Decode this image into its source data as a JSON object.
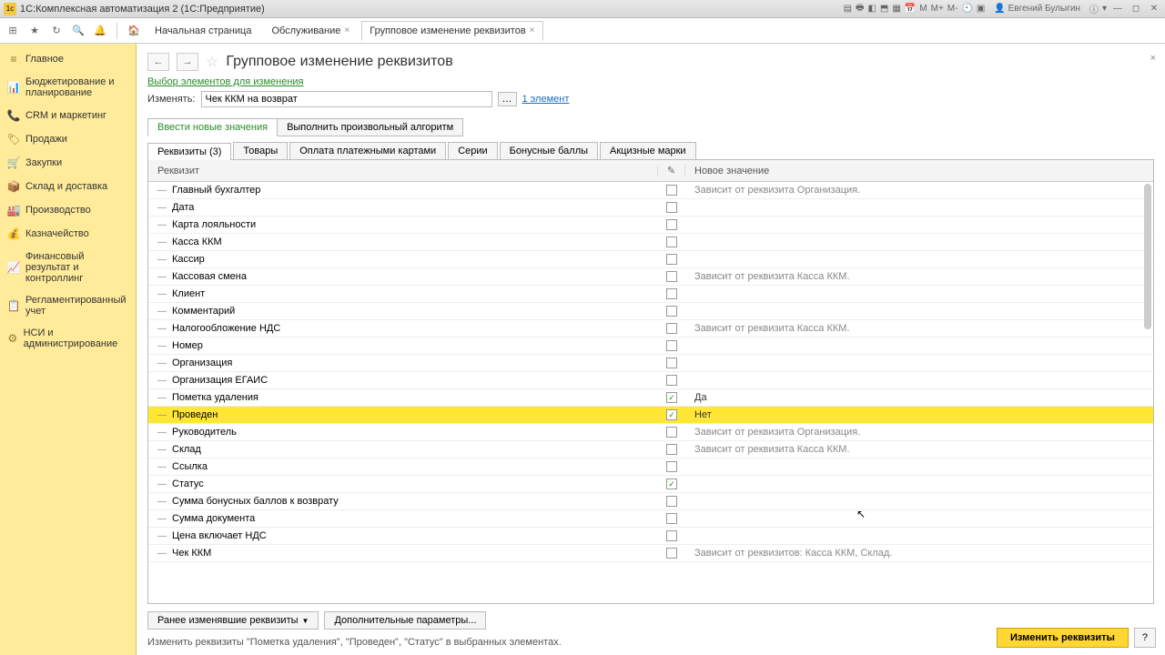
{
  "titlebar": {
    "app": "1С:Комплексная автоматизация 2  (1С:Предприятие)",
    "user": "Евгений Булыгин"
  },
  "tabs": {
    "home": "Начальная страница",
    "t1": "Обслуживание",
    "t2": "Групповое изменение реквизитов"
  },
  "sidebar": {
    "items": [
      "Главное",
      "Бюджетирование и планирование",
      "CRM и маркетинг",
      "Продажи",
      "Закупки",
      "Склад и доставка",
      "Производство",
      "Казначейство",
      "Финансовый результат и контроллинг",
      "Регламентированный учет",
      "НСИ и администрирование"
    ]
  },
  "page": {
    "title": "Групповое изменение реквизитов",
    "select_title": "Выбор элементов для изменения",
    "change_label": "Изменять:",
    "change_value": "Чек ККМ на возврат",
    "count_link": "1 элемент",
    "mode1": "Ввести новые значения",
    "mode2": "Выполнить произвольный алгоритм"
  },
  "inner_tabs": [
    "Реквизиты (3)",
    "Товары",
    "Оплата платежными картами",
    "Серии",
    "Бонусные баллы",
    "Акцизные марки"
  ],
  "grid": {
    "col_name": "Реквизит",
    "col_val": "Новое значение",
    "rows": [
      {
        "name": "Главный бухгалтер",
        "val": "Зависит от реквизита Организация.",
        "chk": false
      },
      {
        "name": "Дата",
        "val": "",
        "chk": false
      },
      {
        "name": "Карта лояльности",
        "val": "",
        "chk": false
      },
      {
        "name": "Касса ККМ",
        "val": "",
        "chk": false
      },
      {
        "name": "Кассир",
        "val": "",
        "chk": false
      },
      {
        "name": "Кассовая смена",
        "val": "Зависит от реквизита Касса ККМ.",
        "chk": false
      },
      {
        "name": "Клиент",
        "val": "",
        "chk": false
      },
      {
        "name": "Комментарий",
        "val": "",
        "chk": false
      },
      {
        "name": "Налогообложение НДС",
        "val": "Зависит от реквизита Касса ККМ.",
        "chk": false
      },
      {
        "name": "Номер",
        "val": "",
        "chk": false
      },
      {
        "name": "Организация",
        "val": "",
        "chk": false
      },
      {
        "name": "Организация ЕГАИС",
        "val": "",
        "chk": false
      },
      {
        "name": "Пометка удаления",
        "val": "Да",
        "chk": true,
        "dark": true
      },
      {
        "name": "Проведен",
        "val": "Нет",
        "chk": true,
        "sel": true,
        "dark": true
      },
      {
        "name": "Руководитель",
        "val": "Зависит от реквизита Организация.",
        "chk": false
      },
      {
        "name": "Склад",
        "val": "Зависит от реквизита Касса ККМ.",
        "chk": false
      },
      {
        "name": "Ссылка",
        "val": "",
        "chk": false
      },
      {
        "name": "Статус",
        "val": "",
        "chk": true
      },
      {
        "name": "Сумма бонусных баллов к возврату",
        "val": "",
        "chk": false
      },
      {
        "name": "Сумма документа",
        "val": "",
        "chk": false
      },
      {
        "name": "Цена включает НДС",
        "val": "",
        "chk": false
      },
      {
        "name": "Чек ККМ",
        "val": "Зависит от реквизитов: Касса ККМ, Склад.",
        "chk": false
      }
    ]
  },
  "footer": {
    "btn1": "Ранее изменявшие реквизиты",
    "btn2": "Дополнительные параметры...",
    "text": "Изменить реквизиты \"Пометка удаления\", \"Проведен\", \"Статус\" в выбранных элементах.",
    "primary": "Изменить реквизиты",
    "help": "?"
  }
}
